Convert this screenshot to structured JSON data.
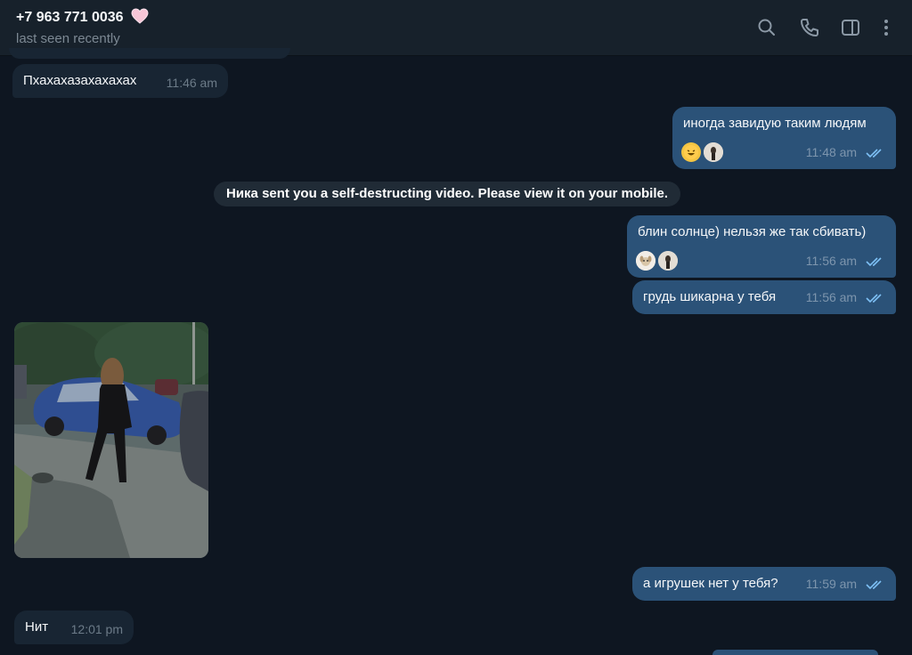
{
  "header": {
    "title": "+7 963 771 0036",
    "status": "last seen recently",
    "icons": [
      "search-icon",
      "phone-icon",
      "sidebar-toggle-icon",
      "more-vertical-icon"
    ]
  },
  "messages": [
    {
      "dir": "in",
      "text": "Пхахахазахахахах",
      "time": "11:46 am"
    },
    {
      "dir": "out",
      "text": "иногда завидую таким людям",
      "time": "11:48 am",
      "reactions": [
        "laughing-emoji",
        "avatar"
      ]
    },
    {
      "dir": "service",
      "text": "Ника sent you a self-destructing video. Please view it on your mobile."
    },
    {
      "dir": "out",
      "text": "блин солнце) нельзя же так сбивать)",
      "time": "11:56 am",
      "reactions": [
        "avatar-dog",
        "avatar"
      ]
    },
    {
      "dir": "out",
      "text": "грудь шикарна у тебя",
      "time": "11:56 am"
    },
    {
      "dir": "in",
      "type": "photo",
      "description": "photo"
    },
    {
      "dir": "out",
      "text": "а игрушек нет у тебя?",
      "time": "11:59 am"
    },
    {
      "dir": "in",
      "text": "Нит",
      "time": "12:01 pm"
    }
  ],
  "colors": {
    "background": "#0e1621",
    "header": "#17212b",
    "incoming_bubble": "#182533",
    "outgoing_bubble": "#2b5278",
    "accent": "#6ab2f2"
  }
}
